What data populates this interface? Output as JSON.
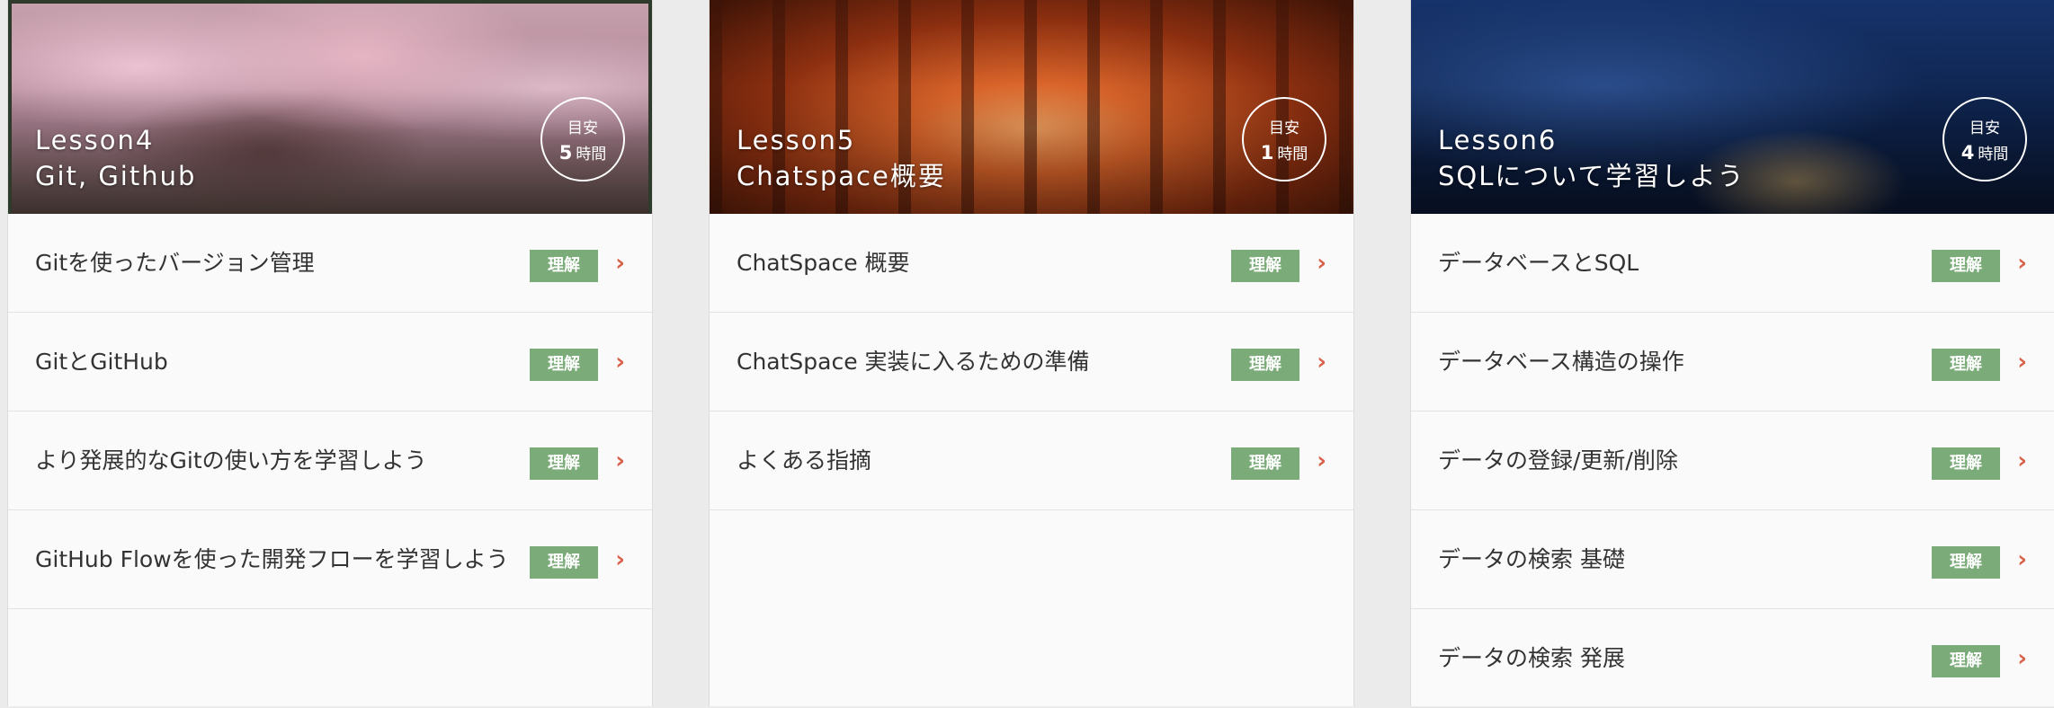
{
  "lessons": [
    {
      "number": "Lesson4",
      "title": "Git, Github",
      "badge": {
        "label": "目安",
        "hours": "5",
        "unit": "時間"
      },
      "items": [
        {
          "label": "Gitを使ったバージョン管理",
          "tag": "理解"
        },
        {
          "label": "GitとGitHub",
          "tag": "理解"
        },
        {
          "label": "より発展的なGitの使い方を学習しよう",
          "tag": "理解"
        },
        {
          "label": "GitHub Flowを使った開発フローを学習しよう",
          "tag": "理解"
        }
      ]
    },
    {
      "number": "Lesson5",
      "title": "Chatspace概要",
      "badge": {
        "label": "目安",
        "hours": "1",
        "unit": "時間"
      },
      "items": [
        {
          "label": "ChatSpace 概要",
          "tag": "理解"
        },
        {
          "label": "ChatSpace 実装に入るための準備",
          "tag": "理解"
        },
        {
          "label": "よくある指摘",
          "tag": "理解"
        }
      ]
    },
    {
      "number": "Lesson6",
      "title": "SQLについて学習しよう",
      "badge": {
        "label": "目安",
        "hours": "4",
        "unit": "時間"
      },
      "items": [
        {
          "label": "データベースとSQL",
          "tag": "理解"
        },
        {
          "label": "データベース構造の操作",
          "tag": "理解"
        },
        {
          "label": "データの登録/更新/削除",
          "tag": "理解"
        },
        {
          "label": "データの検索 基礎",
          "tag": "理解"
        },
        {
          "label": "データの検索 発展",
          "tag": "理解"
        }
      ]
    }
  ],
  "colors": {
    "tag_bg": "#7aab78",
    "arrow": "#d9614a"
  },
  "icons": {
    "arrow": "chevron-right-icon"
  }
}
